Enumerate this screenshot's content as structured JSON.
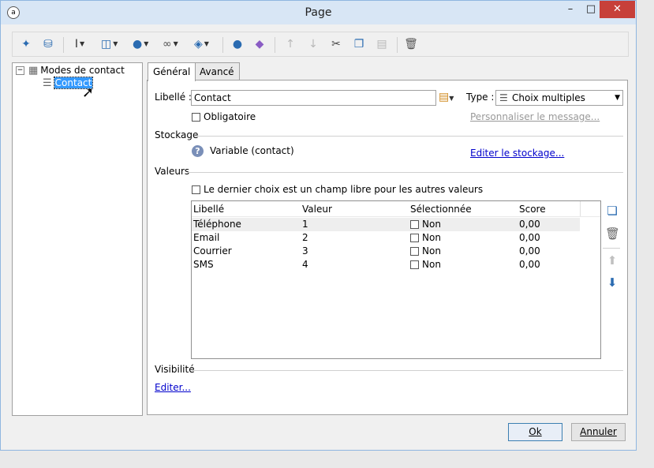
{
  "window": {
    "title": "Page",
    "icon": "app-logo-icon"
  },
  "window_controls": {
    "minimize": "–",
    "maximize": "□",
    "close": "✕"
  },
  "toolbar": {
    "buttons": [
      {
        "icon": "magic-wand-icon"
      },
      {
        "icon": "database-refresh-icon"
      },
      {
        "icon": "text-cursor-icon"
      },
      {
        "icon": "add-field-icon"
      },
      {
        "icon": "globe-icon"
      },
      {
        "icon": "link-icon"
      },
      {
        "icon": "layers-icon"
      },
      {
        "icon": "user-icon"
      },
      {
        "icon": "add-shape-icon"
      },
      {
        "icon": "arrow-up-icon"
      },
      {
        "icon": "arrow-down-icon"
      },
      {
        "icon": "scissors-icon"
      },
      {
        "icon": "copy-icon"
      },
      {
        "icon": "paste-icon"
      },
      {
        "icon": "trash-icon"
      }
    ]
  },
  "tree": {
    "root_label": "Modes de contact",
    "child_label": "Contact",
    "expander": "−"
  },
  "tabs": [
    "Général",
    "Avancé"
  ],
  "form": {
    "libelle_label": "Libellé :",
    "libelle_value": "Contact",
    "type_label": "Type :",
    "type_value": "Choix multiples",
    "obligatoire_label": "Obligatoire",
    "personnaliser_link": "Personnaliser le message...",
    "stockage_label": "Stockage",
    "variable_text": "Variable (contact)",
    "editer_stockage_link": "Editer le stockage...",
    "valeurs_label": "Valeurs",
    "dernier_choix_label": "Le dernier choix est un champ libre pour les autres valeurs",
    "visibilite_label": "Visibilité",
    "editer_link": "Editer..."
  },
  "grid": {
    "columns": [
      "Libellé",
      "Valeur",
      "Sélectionnée",
      "Score"
    ],
    "rows": [
      {
        "libelle": "Téléphone",
        "valeur": "1",
        "selectionnee": "Non",
        "score": "0,00"
      },
      {
        "libelle": "Email",
        "valeur": "2",
        "selectionnee": "Non",
        "score": "0,00"
      },
      {
        "libelle": "Courrier",
        "valeur": "3",
        "selectionnee": "Non",
        "score": "0,00"
      },
      {
        "libelle": "SMS",
        "valeur": "4",
        "selectionnee": "Non",
        "score": "0,00"
      }
    ]
  },
  "buttons": {
    "ok": "Ok",
    "cancel": "Annuler"
  },
  "colors": {
    "accent": "#2a6bb1",
    "selection": "#3399ff",
    "link": "#0000cc",
    "close": "#c7403a"
  }
}
